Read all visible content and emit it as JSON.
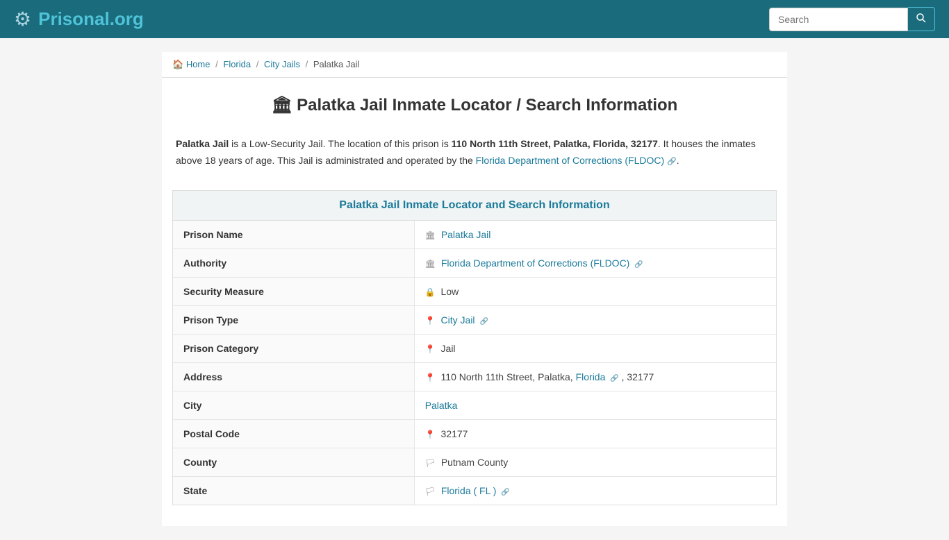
{
  "header": {
    "logo_text_main": "Prisonal",
    "logo_text_ext": ".org",
    "logo_icon": "⚙",
    "search_placeholder": "Search",
    "search_button_icon": "🔍"
  },
  "breadcrumb": {
    "home_label": "Home",
    "home_icon": "🏠",
    "state_label": "Florida",
    "category_label": "City Jails",
    "current_label": "Palatka Jail"
  },
  "page": {
    "title_icon": "🏛",
    "title": "Palatka Jail Inmate Locator / Search Information",
    "description_part1": " is a Low-Security Jail. The location of this prison is ",
    "description_bold1": "Palatka Jail",
    "description_address": "110 North 11th Street, Palatka, Florida, 32177",
    "description_part2": ". It houses the inmates above 18 years of age. This Jail is administrated and operated by the ",
    "description_link": "Florida Department of Corrections (FLDOC)",
    "description_part3": "."
  },
  "info_table": {
    "section_title": "Palatka Jail Inmate Locator and Search Information",
    "rows": [
      {
        "label": "Prison Name",
        "icon": "🏛",
        "value": "Palatka Jail",
        "is_link": true,
        "link_text": "Palatka Jail"
      },
      {
        "label": "Authority",
        "icon": "🏛",
        "value": "Florida Department of Corrections (FLDOC)",
        "is_link": true,
        "link_text": "Florida Department of Corrections (FLDOC)",
        "has_ext": true
      },
      {
        "label": "Security Measure",
        "icon": "🔒",
        "value": "Low",
        "is_link": false
      },
      {
        "label": "Prison Type",
        "icon": "📍",
        "value": "City Jail",
        "is_link": true,
        "link_text": "City Jail",
        "has_chain": true
      },
      {
        "label": "Prison Category",
        "icon": "📍",
        "value": "Jail",
        "is_link": false
      },
      {
        "label": "Address",
        "icon": "📍",
        "value_plain": "110 North 11th Street, Palatka, ",
        "value_link": "Florida",
        "value_after": ", 32177",
        "is_mixed": true
      },
      {
        "label": "City",
        "icon": "",
        "value": "Palatka",
        "is_link": true,
        "link_text": "Palatka"
      },
      {
        "label": "Postal Code",
        "icon": "📍",
        "value": "32177",
        "is_link": false
      },
      {
        "label": "County",
        "icon": "🏳",
        "value": "Putnam County",
        "is_link": false
      },
      {
        "label": "State",
        "icon": "🏳",
        "value": "Florida ( FL )",
        "is_link": true,
        "link_text": "Florida ( FL )",
        "has_chain": true
      }
    ]
  }
}
